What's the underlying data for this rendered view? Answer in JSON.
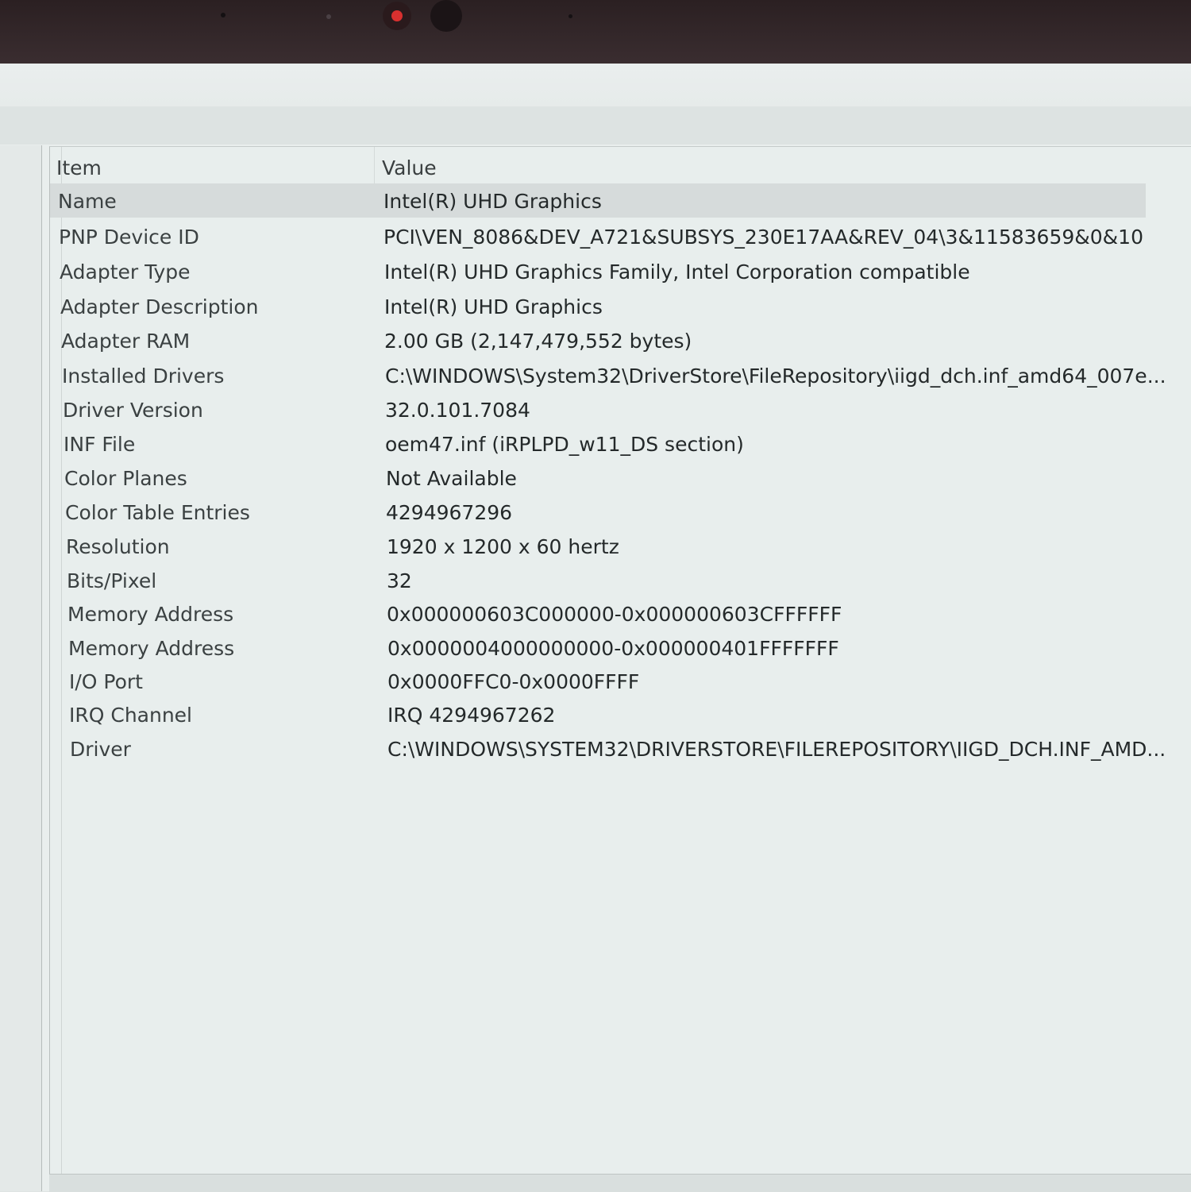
{
  "window": {
    "columns": {
      "item": "Item",
      "value": "Value"
    },
    "rows": [
      {
        "item": "Name",
        "value": "Intel(R) UHD Graphics"
      },
      {
        "item": "PNP Device ID",
        "value": "PCI\\VEN_8086&DEV_A721&SUBSYS_230E17AA&REV_04\\3&11583659&0&10"
      },
      {
        "item": "Adapter Type",
        "value": "Intel(R) UHD Graphics Family, Intel Corporation compatible"
      },
      {
        "item": "Adapter Description",
        "value": "Intel(R) UHD Graphics"
      },
      {
        "item": "Adapter RAM",
        "value": "2.00 GB (2,147,479,552 bytes)"
      },
      {
        "item": "Installed Drivers",
        "value": "C:\\WINDOWS\\System32\\DriverStore\\FileRepository\\iigd_dch.inf_amd64_007e..."
      },
      {
        "item": "Driver Version",
        "value": "32.0.101.7084"
      },
      {
        "item": "INF File",
        "value": "oem47.inf (iRPLPD_w11_DS section)"
      },
      {
        "item": "Color Planes",
        "value": "Not Available"
      },
      {
        "item": "Color Table Entries",
        "value": "4294967296"
      },
      {
        "item": "Resolution",
        "value": "1920 x 1200 x 60 hertz"
      },
      {
        "item": "Bits/Pixel",
        "value": "32"
      },
      {
        "item": "Memory Address",
        "value": "0x000000603C000000-0x000000603CFFFFFF"
      },
      {
        "item": "Memory Address",
        "value": "0x0000004000000000-0x000000401FFFFFFF"
      },
      {
        "item": "I/O Port",
        "value": "0x0000FFC0-0x0000FFFF"
      },
      {
        "item": "IRQ Channel",
        "value": "IRQ 4294967262"
      },
      {
        "item": "Driver",
        "value": "C:\\WINDOWS\\SYSTEM32\\DRIVERSTORE\\FILEREPOSITORY\\IIGD_DCH.INF_AMD..."
      }
    ],
    "selected_row_index": 0
  }
}
